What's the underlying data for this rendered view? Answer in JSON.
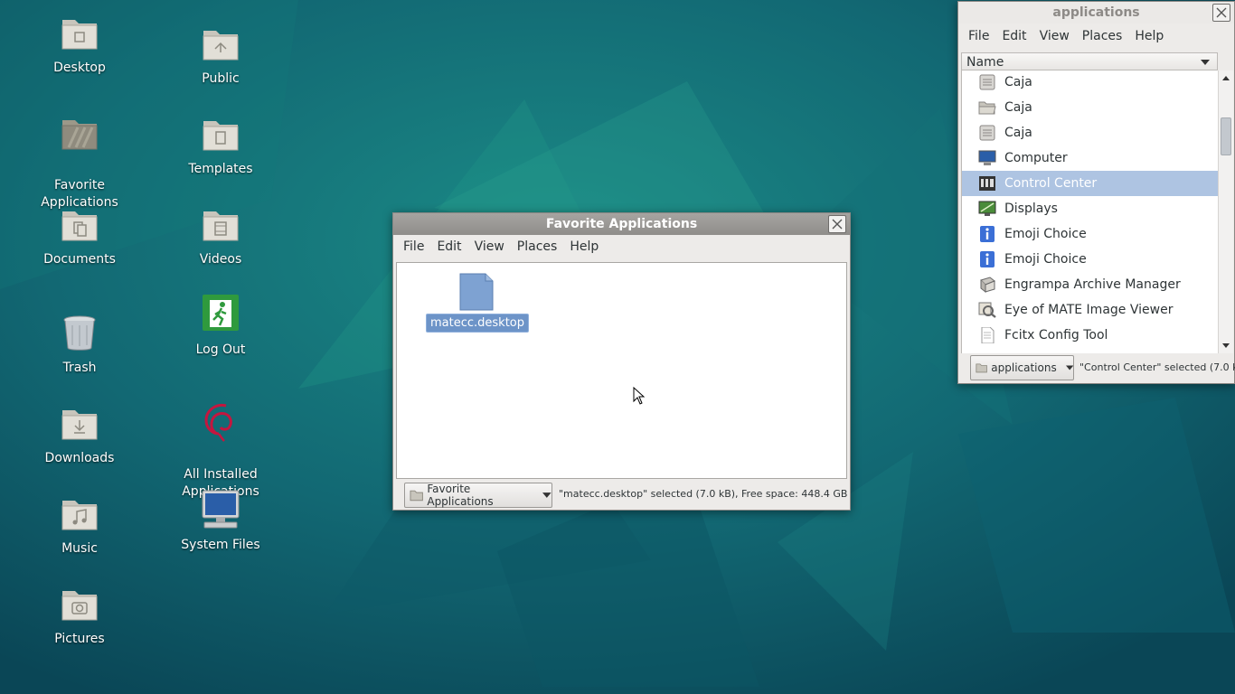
{
  "desktop": {
    "icons": [
      {
        "label": "Desktop",
        "icon": "folder-desktop-icon"
      },
      {
        "label": "Public",
        "icon": "folder-public-icon"
      },
      {
        "label": "Favorite\nApplications",
        "icon": "folder-favorites-icon"
      },
      {
        "label": "Templates",
        "icon": "folder-templates-icon"
      },
      {
        "label": "Documents",
        "icon": "folder-documents-icon"
      },
      {
        "label": "Videos",
        "icon": "folder-videos-icon"
      },
      {
        "label": "Trash",
        "icon": "trash-icon"
      },
      {
        "label": "Log Out",
        "icon": "logout-icon"
      },
      {
        "label": "Downloads",
        "icon": "folder-downloads-icon"
      },
      {
        "label": "All Installed\nApplications",
        "icon": "debian-swirl-icon"
      },
      {
        "label": "Music",
        "icon": "folder-music-icon"
      },
      {
        "label": "System Files",
        "icon": "computer-icon"
      },
      {
        "label": "Pictures",
        "icon": "folder-pictures-icon"
      }
    ]
  },
  "fav_window": {
    "title": "Favorite Applications",
    "menu": [
      "File",
      "Edit",
      "View",
      "Places",
      "Help"
    ],
    "file": {
      "name": "matecc.desktop",
      "icon": "document-icon"
    },
    "location": "Favorite Applications",
    "status": "\"matecc.desktop\" selected (7.0 kB), Free space: 448.4 GB"
  },
  "apps_window": {
    "title": "applications",
    "menu": [
      "File",
      "Edit",
      "View",
      "Places",
      "Help"
    ],
    "column_header": "Name",
    "items": [
      {
        "label": "Caja",
        "icon": "file-manager-icon"
      },
      {
        "label": "Caja",
        "icon": "folder-open-icon"
      },
      {
        "label": "Caja",
        "icon": "file-manager-icon"
      },
      {
        "label": "Computer",
        "icon": "computer-icon"
      },
      {
        "label": "Control Center",
        "icon": "control-center-icon",
        "selected": true
      },
      {
        "label": "Displays",
        "icon": "display-icon"
      },
      {
        "label": "Emoji Choice",
        "icon": "info-icon"
      },
      {
        "label": "Emoji Choice",
        "icon": "info-icon"
      },
      {
        "label": "Engrampa Archive Manager",
        "icon": "archive-icon"
      },
      {
        "label": "Eye of MATE Image Viewer",
        "icon": "image-viewer-icon"
      },
      {
        "label": "Fcitx Config Tool",
        "icon": "text-file-icon"
      }
    ],
    "location": "applications",
    "status": "\"Control Center\" selected (7.0 k..."
  },
  "colors": {
    "selection": "#aec4e2",
    "file_selection": "#6d94c8",
    "desktop_base": "#0f5a66"
  }
}
